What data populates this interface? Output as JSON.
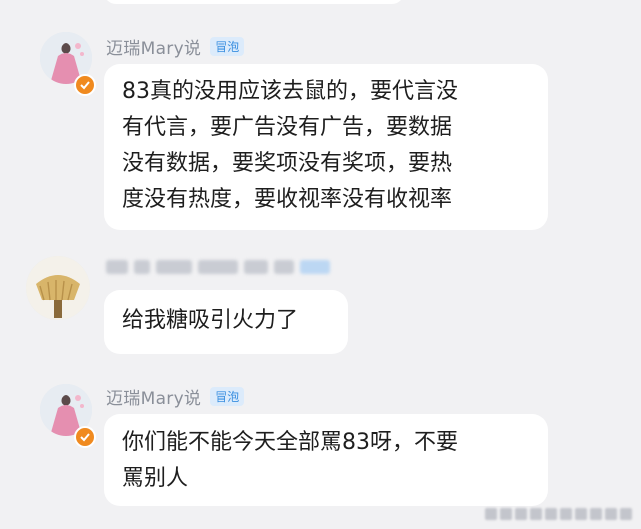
{
  "messages": [
    {
      "sender": "迈瑞Mary说",
      "badge": "冒泡",
      "avatar": "person-in-pink-dress-avatar",
      "verified_icon": "verified-check-icon",
      "lines": [
        "83真的没用应该去鼠的，要代言没",
        "有代言，要广告没有广告，要数据",
        "没有数据，要奖项没有奖项，要热",
        "度没有热度，要收视率没有收视率"
      ]
    },
    {
      "sender": "",
      "avatar": "broom-avatar",
      "lines": [
        "给我糖吸引火力了"
      ]
    },
    {
      "sender": "迈瑞Mary说",
      "badge": "冒泡",
      "avatar": "person-in-pink-dress-avatar",
      "verified_icon": "verified-check-icon",
      "lines": [
        "你们能不能今天全部罵83呀，不要",
        "罵别人"
      ]
    }
  ],
  "colors": {
    "background": "#f1f1f3",
    "bubble": "#ffffff",
    "badge_text": "#3a8fe0",
    "verified": "#f08a1f"
  }
}
